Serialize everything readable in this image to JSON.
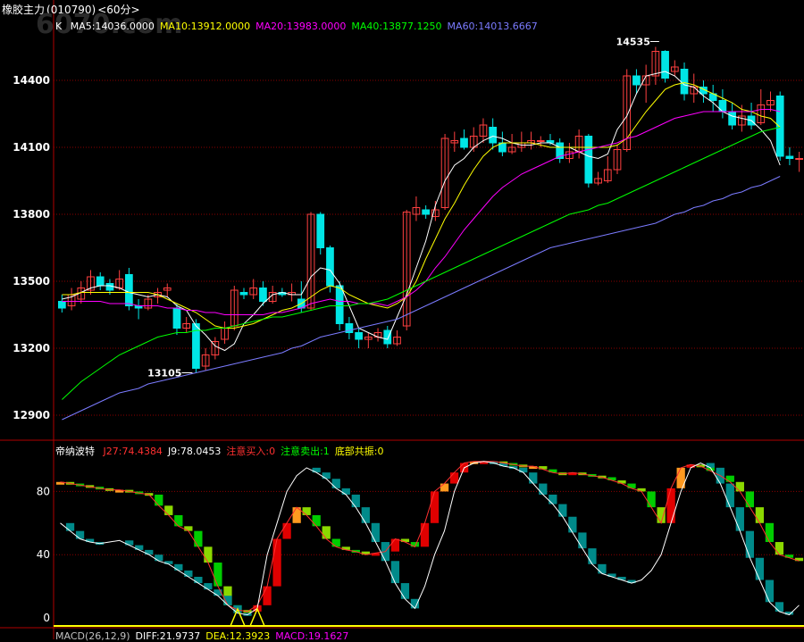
{
  "window": {
    "title": "橡胶主力",
    "code": "(010790)",
    "period": "<60分>",
    "watermark": "6070.com"
  },
  "main_panel": {
    "k_label": "K",
    "ma_legend": [
      {
        "text": "MA5:14036.0000",
        "color": "#ffffff"
      },
      {
        "text": "MA10:13912.0000",
        "color": "#ffff00"
      },
      {
        "text": "MA20:13983.0000",
        "color": "#ff00ff"
      },
      {
        "text": "MA40:13877.1250",
        "color": "#00ff00"
      },
      {
        "text": "MA60:14013.6667",
        "color": "#7b7bff"
      }
    ],
    "y_ticks": [
      "14400",
      "14100",
      "13800",
      "13500",
      "13200",
      "12900"
    ],
    "annotations": {
      "high": "14535",
      "low": "13105"
    }
  },
  "indicator_panel": {
    "name": "帝纳波特",
    "legend": [
      {
        "text": "J27:74.4384",
        "color": "#ff3030"
      },
      {
        "text": "J9:78.0453",
        "color": "#ffffff"
      },
      {
        "text": "注意买入:0",
        "color": "#ff3030"
      },
      {
        "text": "注意卖出:1",
        "color": "#00ff00"
      },
      {
        "text": "底部共振:0",
        "color": "#ffff00"
      }
    ],
    "y_ticks": [
      "80",
      "40",
      "0"
    ]
  },
  "macd_panel": {
    "legend": [
      {
        "text": "MACD(26,12,9)",
        "color": "#c0c0c0"
      },
      {
        "text": "DIFF:21.9737",
        "color": "#ffffff"
      },
      {
        "text": "DEA:12.3923",
        "color": "#ffff00"
      },
      {
        "text": "MACD:19.1627",
        "color": "#ff00ff"
      }
    ]
  },
  "colors": {
    "up": "#ff4040",
    "down": "#00e5e5",
    "grid": "#8b0000",
    "axis": "#b00000",
    "ma5": "#ffffff",
    "ma10": "#ffff00",
    "ma20": "#ff00ff",
    "ma40": "#00ff00",
    "ma60": "#7b7bff"
  },
  "chart_data": [
    {
      "type": "candlestick",
      "title": "橡胶主力",
      "ylim": [
        12800,
        14600
      ],
      "y_ticks": [
        14400,
        14100,
        13800,
        13500,
        13200,
        12900
      ],
      "candles": [
        [
          13410,
          13380,
          13440,
          13360
        ],
        [
          13390,
          13440,
          13470,
          13370
        ],
        [
          13420,
          13470,
          13500,
          13400
        ],
        [
          13460,
          13520,
          13550,
          13440
        ],
        [
          13520,
          13480,
          13540,
          13460
        ],
        [
          13490,
          13460,
          13510,
          13440
        ],
        [
          13470,
          13510,
          13550,
          13460
        ],
        [
          13530,
          13390,
          13560,
          13370
        ],
        [
          13390,
          13380,
          13420,
          13330
        ],
        [
          13380,
          13420,
          13440,
          13370
        ],
        [
          13430,
          13450,
          13470,
          13400
        ],
        [
          13460,
          13470,
          13490,
          13430
        ],
        [
          13380,
          13290,
          13400,
          13260
        ],
        [
          13290,
          13310,
          13340,
          13270
        ],
        [
          13310,
          13110,
          13330,
          13090
        ],
        [
          13120,
          13170,
          13200,
          13100
        ],
        [
          13170,
          13230,
          13250,
          13150
        ],
        [
          13240,
          13290,
          13320,
          13220
        ],
        [
          13300,
          13460,
          13480,
          13280
        ],
        [
          13450,
          13440,
          13470,
          13420
        ],
        [
          13440,
          13470,
          13510,
          13420
        ],
        [
          13470,
          13410,
          13500,
          13390
        ],
        [
          13410,
          13450,
          13480,
          13400
        ],
        [
          13450,
          13440,
          13470,
          13430
        ],
        [
          13440,
          13450,
          13490,
          13410
        ],
        [
          13420,
          13380,
          13500,
          13360
        ],
        [
          13380,
          13800,
          13810,
          13370
        ],
        [
          13800,
          13650,
          13810,
          13620
        ],
        [
          13650,
          13480,
          13660,
          13450
        ],
        [
          13480,
          13310,
          13500,
          13280
        ],
        [
          13310,
          13270,
          13340,
          13240
        ],
        [
          13270,
          13240,
          13290,
          13200
        ],
        [
          13240,
          13250,
          13270,
          13200
        ],
        [
          13250,
          13270,
          13290,
          13230
        ],
        [
          13280,
          13220,
          13300,
          13200
        ],
        [
          13220,
          13250,
          13280,
          13210
        ],
        [
          13300,
          13810,
          13820,
          13280
        ],
        [
          13800,
          13830,
          13880,
          13770
        ],
        [
          13820,
          13800,
          13840,
          13780
        ],
        [
          13790,
          13820,
          13860,
          13770
        ],
        [
          13830,
          14140,
          14160,
          13820
        ],
        [
          14120,
          14130,
          14170,
          14080
        ],
        [
          14140,
          14100,
          14180,
          14090
        ],
        [
          14100,
          14150,
          14190,
          14080
        ],
        [
          14150,
          14200,
          14230,
          14120
        ],
        [
          14190,
          14120,
          14230,
          14090
        ],
        [
          14120,
          14080,
          14170,
          14060
        ],
        [
          14080,
          14100,
          14160,
          14070
        ],
        [
          14100,
          14120,
          14170,
          14080
        ],
        [
          14120,
          14130,
          14170,
          14090
        ],
        [
          14130,
          14130,
          14150,
          14100
        ],
        [
          14130,
          14120,
          14160,
          14110
        ],
        [
          14120,
          14050,
          14140,
          14030
        ],
        [
          14050,
          14080,
          14120,
          14030
        ],
        [
          14080,
          14150,
          14180,
          14050
        ],
        [
          14150,
          13940,
          14160,
          13920
        ],
        [
          13940,
          13960,
          13990,
          13930
        ],
        [
          13950,
          14000,
          14060,
          13940
        ],
        [
          14000,
          14090,
          14110,
          13980
        ],
        [
          14090,
          14420,
          14450,
          14080
        ],
        [
          14420,
          14380,
          14450,
          14340
        ],
        [
          14380,
          14420,
          14470,
          14300
        ],
        [
          14420,
          14530,
          14550,
          14380
        ],
        [
          14530,
          14410,
          14535,
          14390
        ],
        [
          14440,
          14460,
          14490,
          14420
        ],
        [
          14450,
          14340,
          14480,
          14310
        ],
        [
          14340,
          14370,
          14430,
          14300
        ],
        [
          14370,
          14340,
          14400,
          14300
        ],
        [
          14340,
          14310,
          14380,
          14260
        ],
        [
          14310,
          14260,
          14360,
          14230
        ],
        [
          14260,
          14200,
          14300,
          14180
        ],
        [
          14200,
          14240,
          14290,
          14170
        ],
        [
          14240,
          14200,
          14300,
          14180
        ],
        [
          14210,
          14290,
          14360,
          14200
        ],
        [
          14290,
          14310,
          14350,
          14260
        ],
        [
          14330,
          14060,
          14350,
          14040
        ],
        [
          14060,
          14050,
          14100,
          14020
        ],
        [
          14050,
          14050,
          14080,
          13990
        ]
      ],
      "series": [
        {
          "name": "MA5",
          "values": [
            13420,
            13430,
            13450,
            13470,
            13480,
            13480,
            13470,
            13450,
            13440,
            13430,
            13440,
            13430,
            13390,
            13370,
            13300,
            13260,
            13210,
            13190,
            13220,
            13310,
            13350,
            13400,
            13440,
            13450,
            13440,
            13440,
            13520,
            13560,
            13550,
            13490,
            13390,
            13290,
            13270,
            13250,
            13240,
            13340,
            13440,
            13560,
            13680,
            13840,
            13950,
            14020,
            14050,
            14100,
            14130,
            14150,
            14140,
            14120,
            14110,
            14110,
            14120,
            14120,
            14100,
            14100,
            14080,
            14060,
            14050,
            14070,
            14180,
            14240,
            14340,
            14420,
            14430,
            14440,
            14420,
            14380,
            14370,
            14330,
            14300,
            14260,
            14240,
            14230,
            14220,
            14180,
            14130,
            14020
          ]
        },
        {
          "name": "MA10",
          "values": [
            13440,
            13440,
            13450,
            13450,
            13450,
            13450,
            13450,
            13450,
            13450,
            13450,
            13440,
            13420,
            13400,
            13380,
            13360,
            13330,
            13300,
            13290,
            13290,
            13300,
            13310,
            13330,
            13350,
            13370,
            13380,
            13400,
            13430,
            13460,
            13480,
            13470,
            13440,
            13420,
            13400,
            13390,
            13380,
            13400,
            13430,
            13500,
            13600,
            13690,
            13780,
            13850,
            13930,
            14000,
            14060,
            14100,
            14120,
            14120,
            14120,
            14120,
            14110,
            14100,
            14100,
            14100,
            14100,
            14100,
            14100,
            14100,
            14110,
            14140,
            14200,
            14260,
            14310,
            14360,
            14380,
            14390,
            14380,
            14360,
            14340,
            14320,
            14300,
            14270,
            14260,
            14240,
            14230,
            14190
          ]
        },
        {
          "name": "MA20",
          "values": [
            13410,
            13410,
            13410,
            13410,
            13410,
            13400,
            13400,
            13400,
            13390,
            13390,
            13390,
            13380,
            13380,
            13370,
            13370,
            13360,
            13360,
            13350,
            13350,
            13350,
            13350,
            13350,
            13360,
            13360,
            13370,
            13380,
            13400,
            13410,
            13420,
            13410,
            13410,
            13400,
            13400,
            13400,
            13390,
            13410,
            13430,
            13460,
            13500,
            13560,
            13610,
            13670,
            13730,
            13780,
            13830,
            13880,
            13920,
            13950,
            13980,
            14000,
            14020,
            14040,
            14060,
            14070,
            14080,
            14090,
            14100,
            14110,
            14120,
            14140,
            14150,
            14170,
            14190,
            14210,
            14230,
            14240,
            14250,
            14260,
            14260,
            14260,
            14260,
            14260,
            14260,
            14270,
            14270,
            14260
          ]
        },
        {
          "name": "MA40",
          "values": [
            12970,
            13010,
            13050,
            13080,
            13110,
            13140,
            13170,
            13190,
            13210,
            13230,
            13250,
            13260,
            13270,
            13270,
            13280,
            13280,
            13290,
            13290,
            13300,
            13310,
            13320,
            13330,
            13340,
            13340,
            13350,
            13360,
            13370,
            13380,
            13390,
            13390,
            13390,
            13400,
            13400,
            13410,
            13420,
            13440,
            13460,
            13480,
            13500,
            13520,
            13540,
            13560,
            13580,
            13600,
            13620,
            13640,
            13660,
            13680,
            13700,
            13720,
            13740,
            13760,
            13780,
            13800,
            13810,
            13820,
            13840,
            13850,
            13870,
            13890,
            13910,
            13930,
            13950,
            13970,
            13990,
            14010,
            14030,
            14050,
            14070,
            14090,
            14110,
            14130,
            14150,
            14170,
            14180,
            14190
          ]
        },
        {
          "name": "MA60",
          "values": [
            12880,
            12900,
            12920,
            12940,
            12960,
            12980,
            13000,
            13010,
            13020,
            13040,
            13050,
            13060,
            13070,
            13080,
            13090,
            13100,
            13110,
            13120,
            13130,
            13140,
            13150,
            13160,
            13170,
            13180,
            13200,
            13210,
            13230,
            13250,
            13260,
            13270,
            13280,
            13290,
            13300,
            13310,
            13320,
            13330,
            13350,
            13370,
            13390,
            13410,
            13430,
            13450,
            13470,
            13490,
            13510,
            13530,
            13550,
            13570,
            13590,
            13610,
            13630,
            13650,
            13660,
            13670,
            13680,
            13690,
            13700,
            13710,
            13720,
            13730,
            13740,
            13750,
            13760,
            13780,
            13800,
            13810,
            13830,
            13840,
            13860,
            13870,
            13890,
            13900,
            13920,
            13930,
            13950,
            13970
          ]
        }
      ]
    },
    {
      "type": "line",
      "title": "帝纳波特",
      "ylim": [
        0,
        100
      ],
      "y_ticks": [
        80,
        40,
        0
      ],
      "series": [
        {
          "name": "J27",
          "values": [
            86,
            85,
            84,
            83,
            82,
            81,
            81,
            80,
            79,
            78,
            71,
            65,
            58,
            55,
            45,
            35,
            20,
            8,
            5,
            4,
            8,
            20,
            50,
            60,
            70,
            65,
            58,
            50,
            45,
            43,
            42,
            40,
            41,
            42,
            50,
            48,
            45,
            60,
            80,
            85,
            92,
            98,
            99,
            99,
            99,
            98,
            97,
            96,
            96,
            94,
            92,
            91,
            92,
            91,
            90,
            89,
            87,
            85,
            82,
            80,
            70,
            60,
            82,
            95,
            97,
            96,
            93,
            90,
            86,
            80,
            70,
            60,
            48,
            40,
            38,
            36
          ]
        },
        {
          "name": "J9",
          "values": [
            60,
            55,
            50,
            48,
            47,
            48,
            49,
            46,
            43,
            40,
            36,
            34,
            30,
            26,
            22,
            18,
            14,
            8,
            3,
            2,
            6,
            40,
            60,
            80,
            90,
            95,
            92,
            88,
            82,
            78,
            70,
            60,
            48,
            36,
            22,
            12,
            6,
            20,
            40,
            55,
            80,
            95,
            98,
            99,
            98,
            96,
            95,
            92,
            85,
            78,
            72,
            64,
            54,
            44,
            34,
            28,
            26,
            24,
            22,
            24,
            30,
            40,
            60,
            80,
            95,
            98,
            95,
            85,
            70,
            55,
            38,
            24,
            10,
            4,
            2,
            8
          ]
        }
      ]
    }
  ]
}
